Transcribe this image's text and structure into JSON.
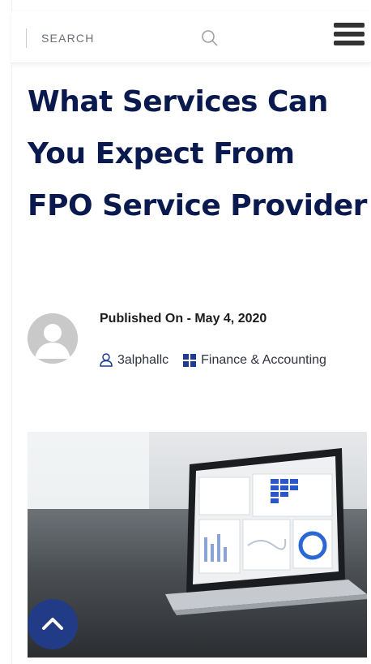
{
  "header": {
    "search_placeholder": "SEARCH",
    "icons": {
      "search": "search-icon",
      "menu": "hamburger-menu-icon"
    }
  },
  "article": {
    "title": "What Services Can You Expect From FPO Service Provider",
    "published": "Published On - May 4, 2020",
    "author": "3alphallc",
    "category": "Finance & Accounting"
  },
  "hero": {
    "description_icon": "laptop-dashboard-image"
  },
  "back_to_top": {
    "icon": "chevron-up-icon"
  },
  "colors": {
    "title": "#0b1a4e",
    "accent": "#223b86",
    "category_icon": "#1d3c8f"
  }
}
